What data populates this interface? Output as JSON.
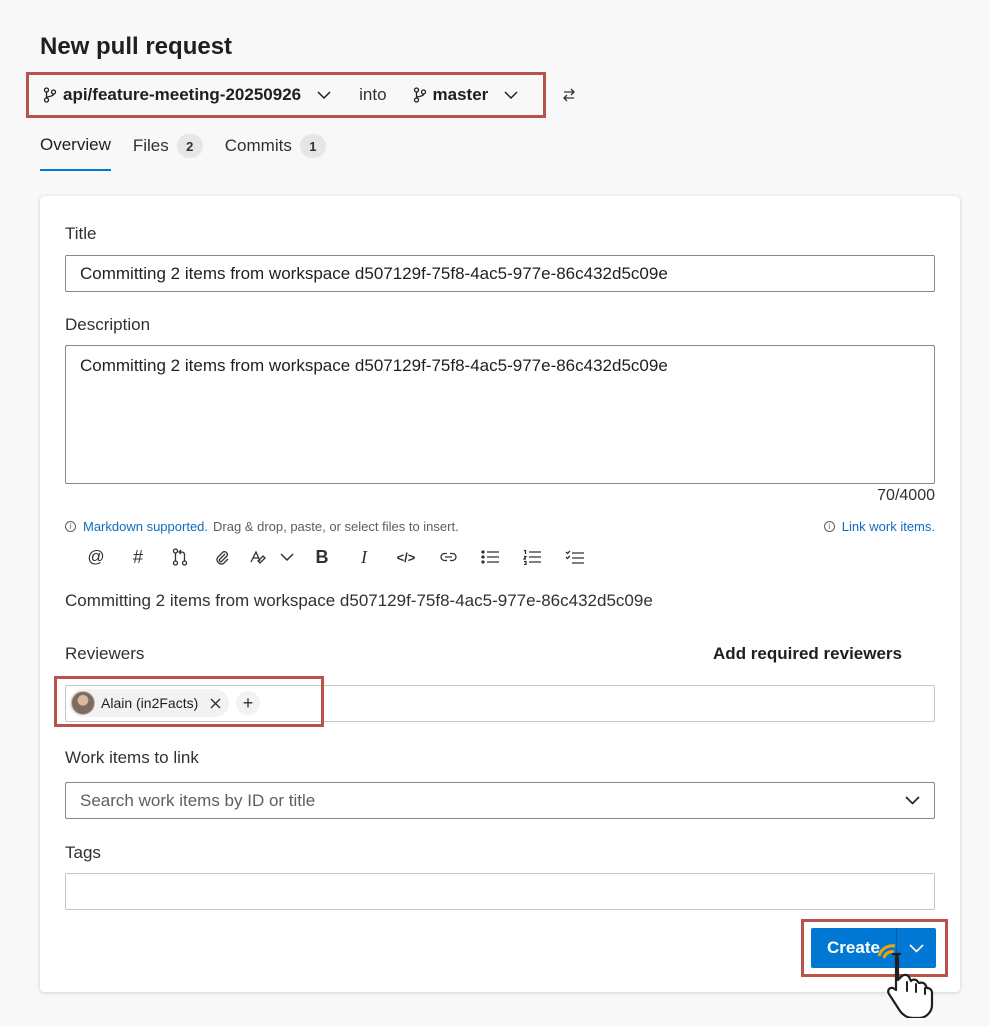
{
  "page": {
    "title": "New pull request"
  },
  "branches": {
    "source": "api/feature-meeting-20250926",
    "connector": "into",
    "target": "master",
    "branch_icon": "git-branch-icon",
    "swap_icon": "swap-arrows-icon"
  },
  "tabs": [
    {
      "label": "Overview",
      "count": null,
      "active": true
    },
    {
      "label": "Files",
      "count": "2",
      "active": false
    },
    {
      "label": "Commits",
      "count": "1",
      "active": false
    }
  ],
  "form": {
    "title_label": "Title",
    "title_value": "Committing 2 items from workspace d507129f-75f8-4ac5-977e-86c432d5c09e",
    "description_label": "Description",
    "description_value": "Committing 2 items from workspace d507129f-75f8-4ac5-977e-86c432d5c09e",
    "char_counter": "70/4000",
    "markdown_link": "Markdown supported.",
    "hint_text": "Drag & drop, paste, or select files to insert.",
    "link_work_items": "Link work items.",
    "toolbar_icons": [
      "mention-icon",
      "hash-icon",
      "pull-request-icon",
      "attach-icon",
      "highlight-icon",
      "chevron-down-icon",
      "bold-icon",
      "italic-icon",
      "code-icon",
      "link-icon",
      "bulleted-list-icon",
      "numbered-list-icon",
      "task-list-icon"
    ],
    "preview_text": "Committing 2 items from workspace d507129f-75f8-4ac5-977e-86c432d5c09e",
    "reviewers_label": "Reviewers",
    "add_required_reviewers": "Add required reviewers",
    "reviewer_name": "Alain (in2Facts)",
    "work_items_label": "Work items to link",
    "work_items_placeholder": "Search work items by ID or title",
    "tags_label": "Tags",
    "tags_value": ""
  },
  "actions": {
    "create_label": "Create"
  },
  "colors": {
    "accent": "#0078d4",
    "highlight": "#b9514d",
    "background": "#f8f8f8"
  }
}
